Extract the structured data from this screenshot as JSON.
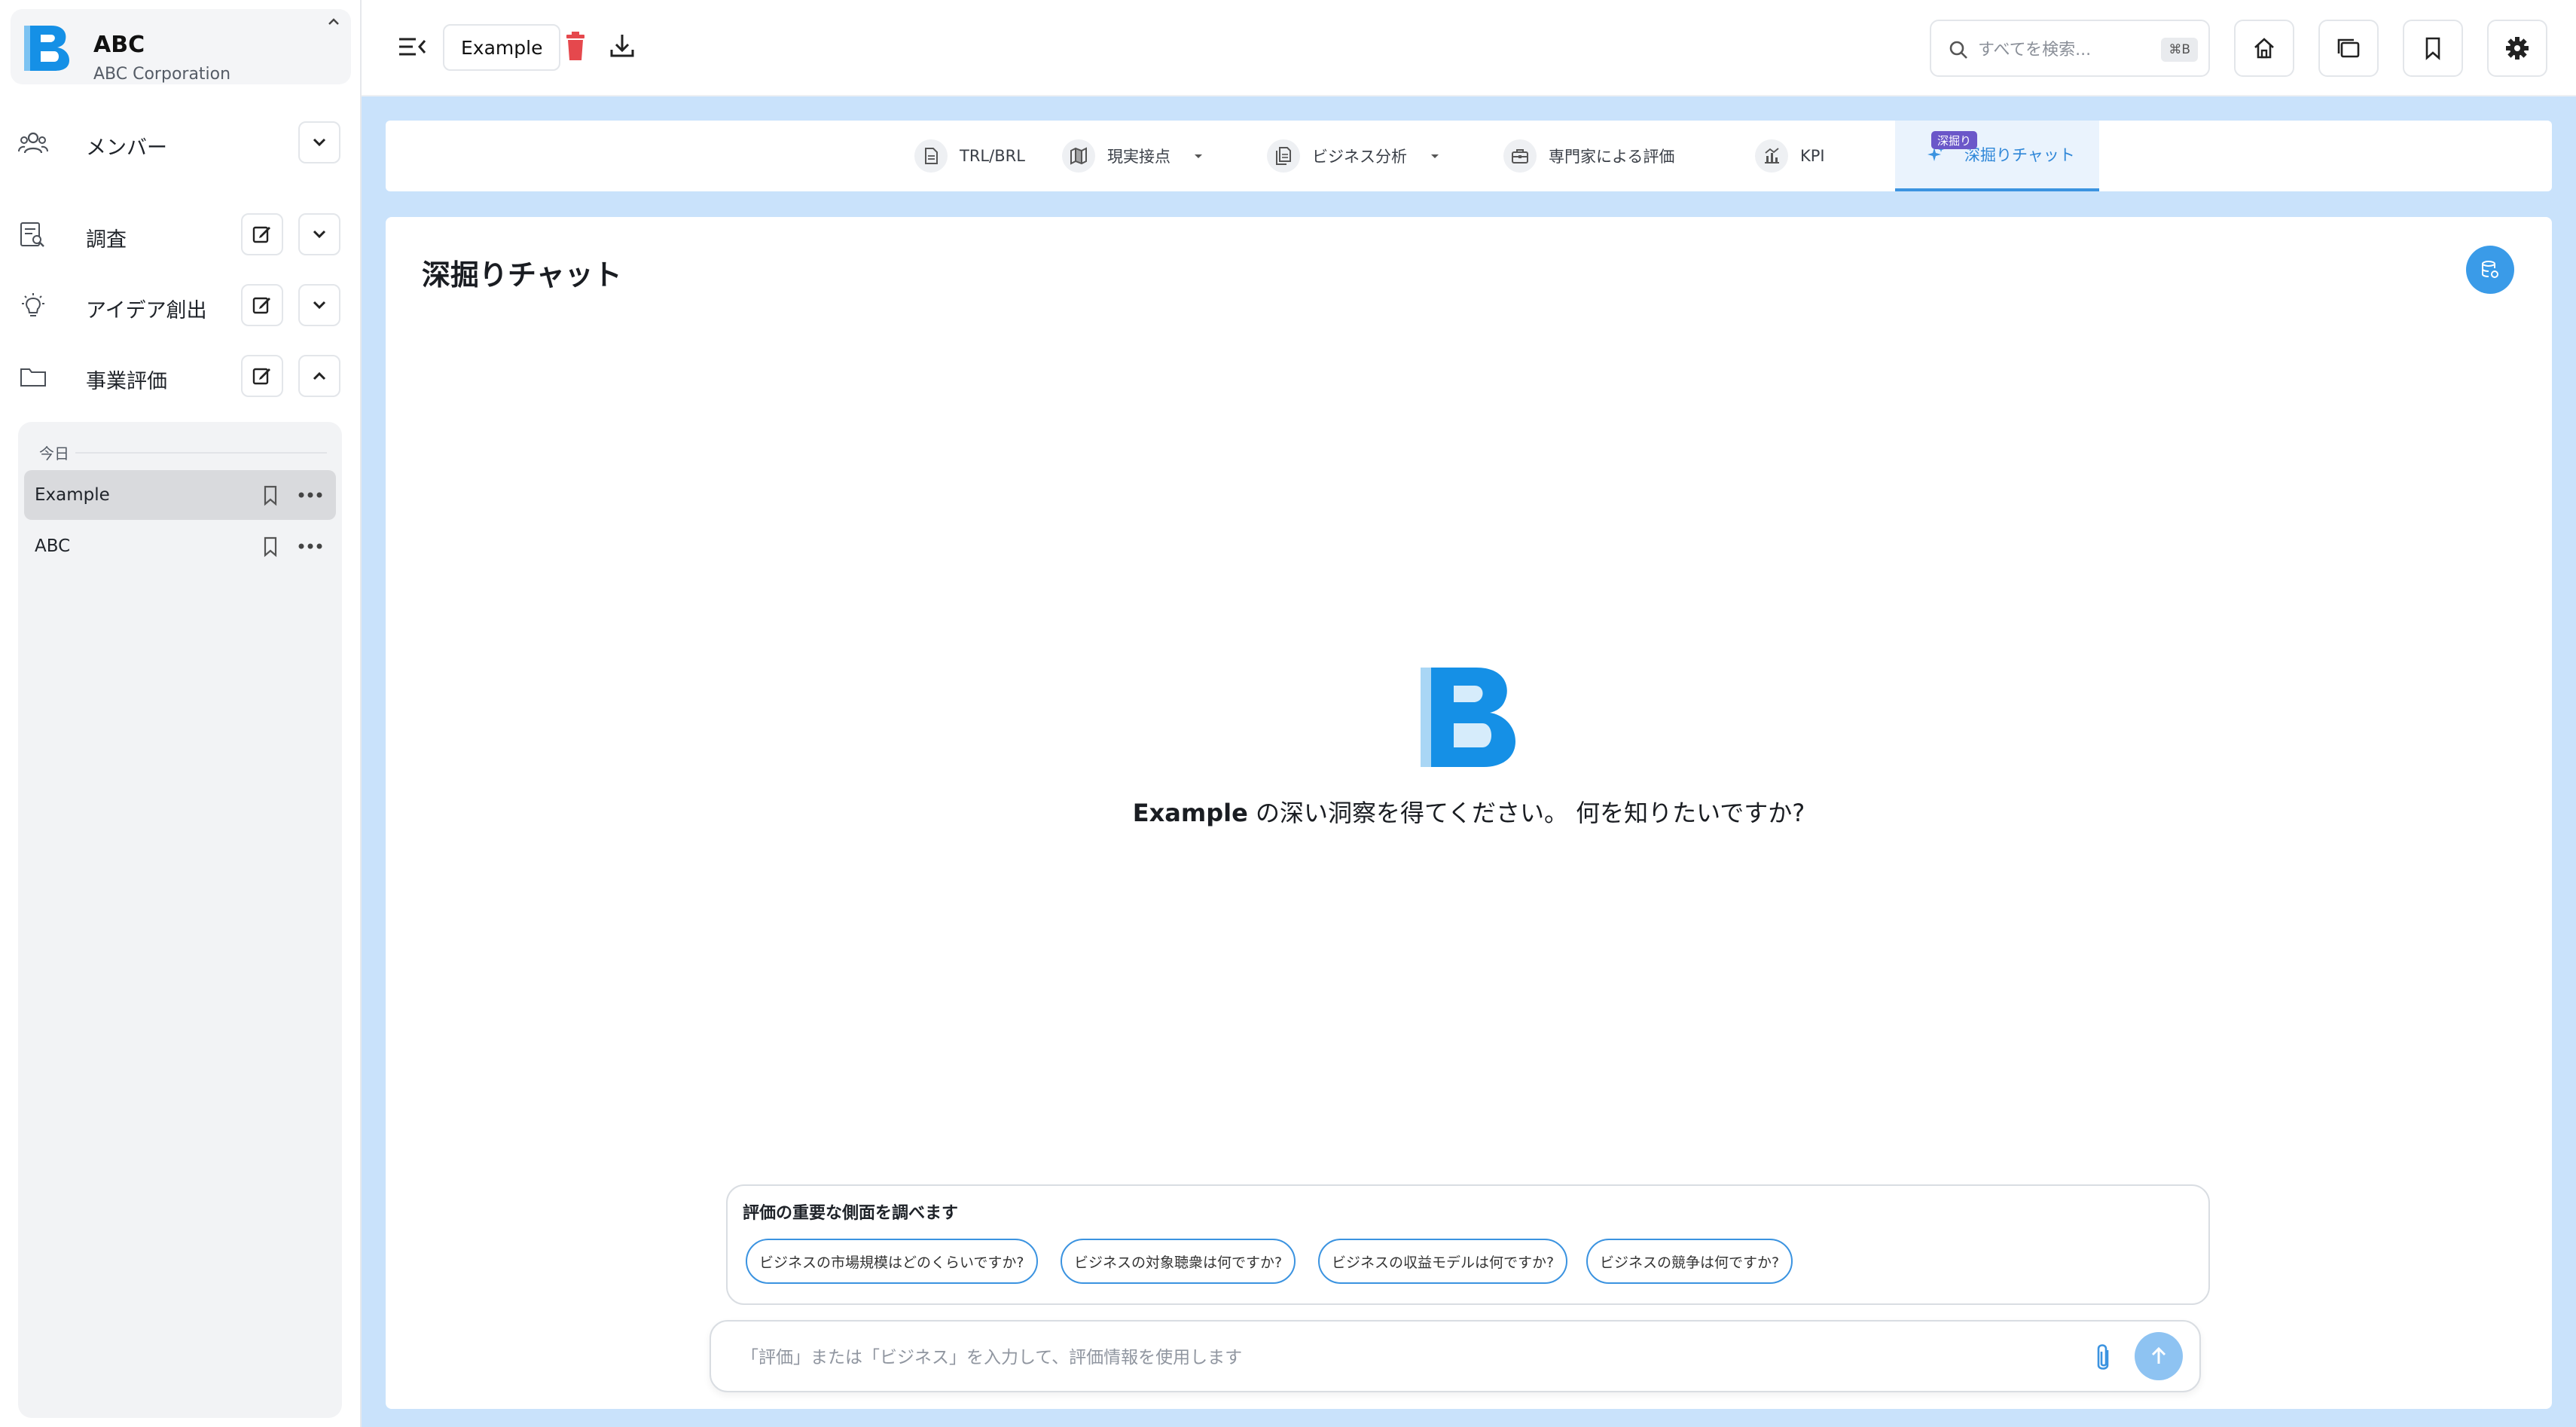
{
  "org": {
    "name": "ABC",
    "subtitle": "ABC Corporation"
  },
  "sidebar": {
    "nav": [
      {
        "label": "メンバー",
        "icon": "users-icon"
      },
      {
        "label": "調査",
        "icon": "research-doc-icon"
      },
      {
        "label": "アイデア創出",
        "icon": "lightbulb-icon"
      },
      {
        "label": "事業評価",
        "icon": "folder-icon"
      }
    ],
    "history": {
      "date_label": "今日",
      "items": [
        {
          "label": "Example",
          "active": true
        },
        {
          "label": "ABC",
          "active": false
        }
      ]
    }
  },
  "topbar": {
    "doc_title": "Example",
    "search_placeholder": "すべてを検索...",
    "search_shortcut": "⌘B"
  },
  "tabs": [
    {
      "label": "TRL/BRL",
      "icon": "document-icon"
    },
    {
      "label": "現実接点",
      "icon": "map-icon"
    },
    {
      "label": "ビジネス分析",
      "icon": "documents-icon"
    },
    {
      "label": "専門家による評価",
      "icon": "briefcase-icon"
    },
    {
      "label": "KPI",
      "icon": "chart-icon"
    },
    {
      "label": "深掘りチャット",
      "icon": "sparkle-icon",
      "badge": "深掘り",
      "active": true
    }
  ],
  "content": {
    "title": "深掘りチャット",
    "question_subject": "Example",
    "question_text": " の深い洞察を得てください。 何を知りたいですか?",
    "suggest_title": "評価の重要な側面を調べます",
    "suggestions": [
      "ビジネスの市場規模はどのくらいですか?",
      "ビジネスの対象聴衆は何ですか?",
      "ビジネスの収益モデルは何ですか?",
      "ビジネスの競争は何ですか?"
    ],
    "composer_placeholder": "「評価」または「ビジネス」を入力して、評価情報を使用します"
  },
  "colors": {
    "accent": "#3b93e0",
    "main_background": "#c9e2fb",
    "delete": "#e5484d",
    "badge": "#6b57c9"
  }
}
